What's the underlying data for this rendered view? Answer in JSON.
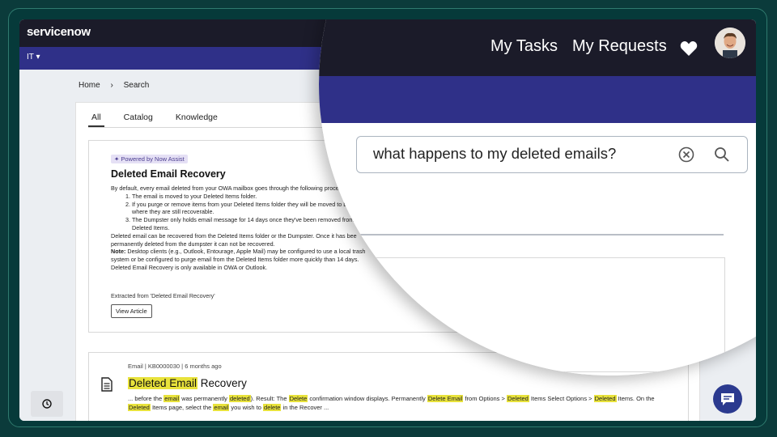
{
  "app": {
    "logo": "servicenow",
    "menu": "IT"
  },
  "breadcrumb": {
    "home": "Home",
    "current": "Search"
  },
  "tabs": [
    {
      "label": "All"
    },
    {
      "label": "Catalog"
    },
    {
      "label": "Knowledge"
    }
  ],
  "ai_card": {
    "badge": "✦ Powered by Now Assist",
    "title": "Deleted Email Recovery",
    "intro": "By default, every email deleted from your OWA mailbox goes through the following proce",
    "steps": [
      "The email is moved to your Deleted Items folder.",
      "If you purge or remove items from your Deleted Items folder they will be moved to Dumpster where they are still recoverable.",
      "The Dumpster only holds email message for 14 days once they've been removed from Deleted Items."
    ],
    "para1": "Deleted email can be recovered from the Deleted Items folder or the Dumpster. Once it has bee permanently deleted from the dumpster it can not be recovered.",
    "note_label": "Note:",
    "note_text": " Desktop clients (e.g., Outlook, Entourage, Apple Mail) may be configured to use a local trash system or be configured to purge email from the Deleted Items folder more quickly than 14 days.",
    "para2": "Deleted Email Recovery is only available in OWA or Outlook.",
    "extracted": "Extracted from 'Deleted Email Recovery'",
    "button": "View Article"
  },
  "result": {
    "meta": "Email | KB0000030 | 6 months ago",
    "title_hl": "Deleted Email",
    "title_rest": " Recovery",
    "snippet": [
      {
        "t": "... before the "
      },
      {
        "t": "email",
        "hl": true
      },
      {
        "t": " was permanently "
      },
      {
        "t": "deleted",
        "hl": true
      },
      {
        "t": "). Result: The "
      },
      {
        "t": "Delete",
        "hl": true
      },
      {
        "t": " confirmation window displays. Permanently "
      },
      {
        "t": "Delete Email",
        "hl": true
      },
      {
        "t": " from Options > "
      },
      {
        "t": "Deleted",
        "hl": true
      },
      {
        "t": " Items Select Options > "
      },
      {
        "t": "Deleted",
        "hl": true
      },
      {
        "t": " Items. On the "
      },
      {
        "t": "Deleted",
        "hl": true
      },
      {
        "t": " Items page, select the "
      },
      {
        "t": "email",
        "hl": true
      },
      {
        "t": " you wish to "
      },
      {
        "t": "delete",
        "hl": true
      },
      {
        "t": " in the Recover ..."
      }
    ]
  },
  "magnified": {
    "nav": {
      "my_tasks": "My Tasks",
      "my_requests": "My Requests"
    },
    "search_value": "what happens to my deleted emails?"
  },
  "icons": [
    "heart-icon",
    "clear-icon",
    "search-icon",
    "history-icon",
    "chat-icon",
    "document-icon",
    "chevron-right-icon",
    "caret-down-icon"
  ],
  "colors": {
    "topbar": "#1b1b29",
    "subbar": "#2f3088",
    "logo_accent": "#62d84e",
    "highlight": "#e8e23b",
    "chat": "#2b3a8f"
  }
}
